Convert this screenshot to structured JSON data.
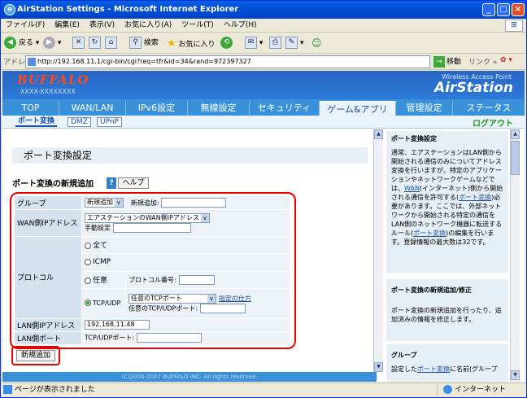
{
  "window": {
    "title": "AirStation Settings - Microsoft Internet Explorer"
  },
  "menu": [
    "ファイル(F)",
    "編集(E)",
    "表示(V)",
    "お気に入り(A)",
    "ツール(T)",
    "ヘルプ(H)"
  ],
  "toolbar": {
    "back": "戻る",
    "search": "検索",
    "favorites": "お気に入り"
  },
  "address": {
    "label": "アドレス(D)",
    "url": "http://192.168.11.1/cgi-bin/cgi?req=tfr&id=34&rand=972397327",
    "go": "移動",
    "links": "リンク »"
  },
  "header": {
    "logo": "BUFFALO",
    "model": "XXXX-XXXXXXXX",
    "tagline": "Wireless Access Point",
    "brand": "AirStation"
  },
  "nav": {
    "tabs": [
      "TOP",
      "WAN/LAN",
      "IPv6設定",
      "無線設定",
      "セキュリティ",
      "ゲーム&アプリ",
      "管理設定",
      "ステータス"
    ],
    "active": "ゲーム&アプリ"
  },
  "subnav": {
    "items": [
      "ポート変換",
      "DMZ",
      "UPnP"
    ],
    "logout": "ログアウト"
  },
  "page": {
    "title": "ポート変換設定",
    "section": "ポート変換の新規追加",
    "help_button": "ヘルプ",
    "help_q": "?"
  },
  "form": {
    "group_label": "グループ",
    "group_select": "新規追加",
    "group_new_label": "新規追加:",
    "wan_label": "WAN側IPアドレス",
    "wan_select": "エアステーションのWAN側IPアドレス",
    "wan_manual": "手動設定",
    "protocol_label": "プロトコル",
    "opt_all": "全て",
    "opt_icmp": "ICMP",
    "opt_any": "任意",
    "proto_num_label": "プロトコル番号:",
    "opt_tcpudp": "TCP/UDP",
    "tcp_select": "任意のTCPポート",
    "how_to": "指定の仕方",
    "any_port_label": "任意のTCP/UDPポート:",
    "lan_ip_label": "LAN側IPアドレス",
    "lan_ip_value": "192.168.11.48",
    "lan_port_label": "LAN側ポート",
    "lan_port_field": "TCP/UDPポート:",
    "add_button": "新規追加"
  },
  "footer": "(C)2000-2007 BUFFALO INC. All rights reserved.",
  "help": {
    "h1": "ポート変換設定",
    "p1a": "通常、エアステーションはLAN側から開始される通信のみについてアドレス変換を行いますが、特定のアプリケーションやネットワークゲームなどでは、",
    "p1_link1": "WAN",
    "p1b": "(インターネット)側から開始される通信を許可する(",
    "p1_link2": "ポート変換",
    "p1c": ")必要があります。ここでは、外部ネットワークから開始される特定の通信をLAN側のネットワーク機器に転送するルール(",
    "p1_link3": "ポート変換",
    "p1d": ")の編集を行います。登録情報の最大数は32です。",
    "h2": "ポート変換の新規追加/修正",
    "p2": "ポート変換の新規追加を行ったり、追加済みの情報を修正します。",
    "h3": "グループ",
    "p3a": "設定した",
    "p3_link": "ポート変換",
    "p3b": "に名前(グループ"
  },
  "status": {
    "text": "ページが表示されました",
    "zone": "インターネット"
  }
}
